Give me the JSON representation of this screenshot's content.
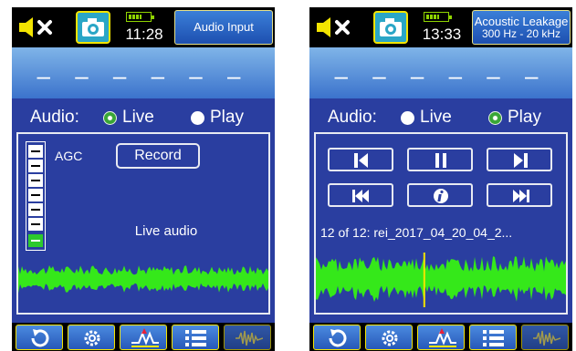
{
  "screens": [
    {
      "mode_line1": "Audio Input",
      "mode_line2": "",
      "clock": "11:28",
      "display_value": "– – – – – –",
      "audio_label": "Audio:",
      "live_label": "Live",
      "play_label": "Play",
      "selected_source": "Live",
      "agc_label": "AGC",
      "record_label": "Record",
      "status_text": "Live audio"
    },
    {
      "mode_line1": "Acoustic Leakage",
      "mode_line2": "300 Hz - 20 kHz",
      "clock": "13:33",
      "display_value": "– – – – – –",
      "audio_label": "Audio:",
      "live_label": "Live",
      "play_label": "Play",
      "selected_source": "Play",
      "file_label": "12 of 12: rei_2017_04_20_04_2..."
    }
  ],
  "icons": {
    "mute": "speaker-mute-icon",
    "camera": "camera-icon",
    "battery": "battery-icon",
    "refresh": "refresh-icon",
    "settings": "gear-icon",
    "filter": "filter-icon",
    "list": "list-icon",
    "waveform": "waveform-icon",
    "skip_start": "skip-to-start-icon",
    "pause": "pause-icon",
    "skip_end": "skip-to-end-icon",
    "previous": "previous-track-icon",
    "info": "info-icon",
    "next": "next-track-icon"
  },
  "colors": {
    "panel_bg": "#2a3ea0",
    "accent_yellow": "#f3e400",
    "wave_green": "#35e81a",
    "cursor_yellow": "#f3e400",
    "radio_green": "#39a636"
  },
  "playback_position": 0.43
}
